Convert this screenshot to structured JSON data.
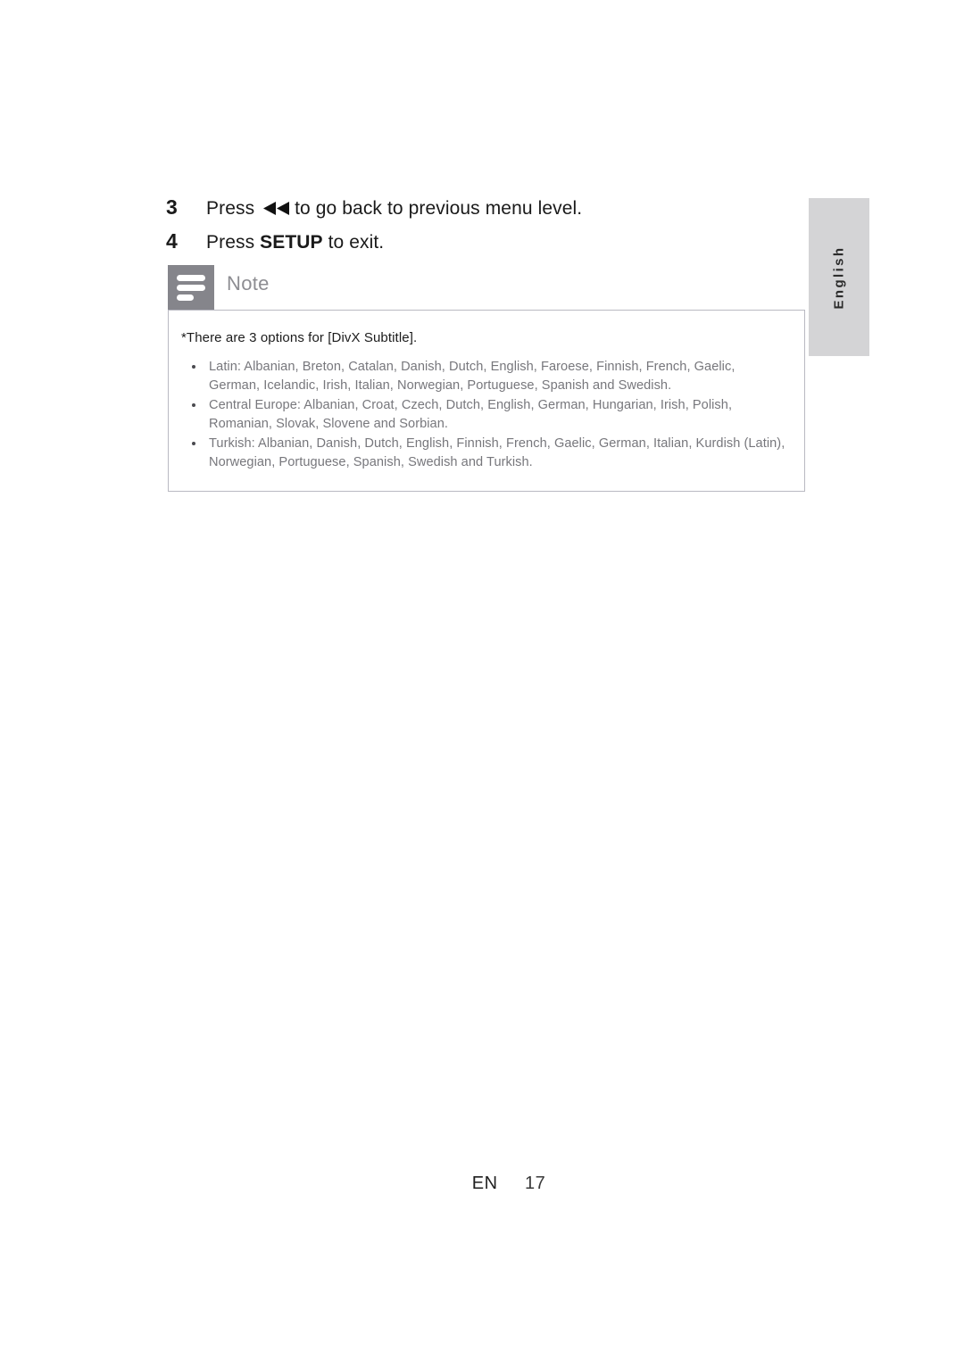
{
  "page": {
    "language_tab": "English",
    "footer": {
      "language_code": "EN",
      "page_number": "17"
    }
  },
  "steps": [
    {
      "number": "3",
      "text_before": "Press",
      "icon": "rewind-icon",
      "text_after": "to go back to previous menu level."
    },
    {
      "number": "4",
      "text_before": "Press",
      "bold": "SETUP",
      "text_after": "to exit."
    }
  ],
  "note": {
    "icon": "note-lines-icon",
    "title": "Note",
    "intro": "*There are 3 options for [DivX Subtitle].",
    "items": [
      "Latin: Albanian, Breton, Catalan, Danish, Dutch, English, Faroese, Finnish, French, Gaelic, German, Icelandic, Irish, Italian, Norwegian, Portuguese, Spanish and Swedish.",
      "Central Europe: Albanian, Croat, Czech, Dutch, English, German, Hungarian, Irish, Polish, Romanian, Slovak, Slovene and Sorbian.",
      "Turkish: Albanian, Danish, Dutch, English, Finnish, French, Gaelic, German, Italian, Kurdish (Latin), Norwegian, Portuguese, Spanish, Swedish and Turkish."
    ]
  },
  "colors": {
    "tab_background": "#d4d4d6",
    "note_icon_background": "#85858b",
    "note_title": "#8d8d92",
    "note_border": "#b9b9c2",
    "body_text": "#77777c",
    "heading_text": "#1a1a1a"
  }
}
